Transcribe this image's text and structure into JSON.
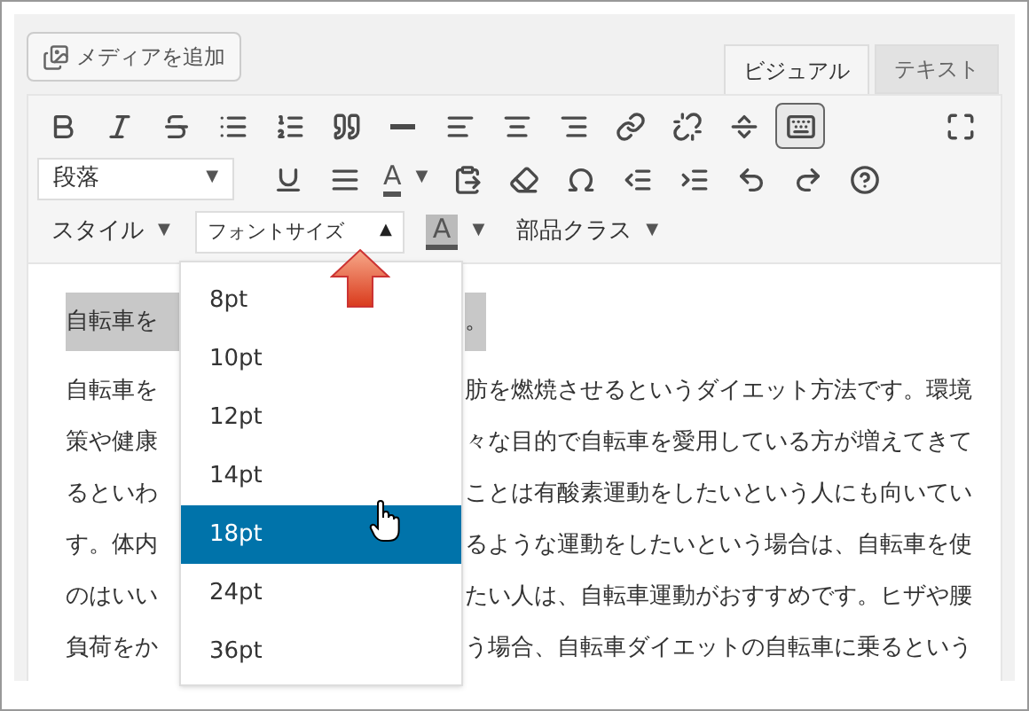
{
  "media_button": {
    "label": "メディアを追加"
  },
  "tabs": [
    {
      "label": "ビジュアル",
      "selected": true
    },
    {
      "label": "テキスト",
      "selected": false
    }
  ],
  "toolbar_row_1": [
    {
      "selected": false
    },
    {
      "selected": false
    },
    {
      "selected": false
    },
    {
      "selected": false
    },
    {
      "selected": false
    },
    {
      "selected": false
    },
    {
      "selected": false
    },
    {
      "selected": false
    },
    {
      "selected": false
    },
    {
      "selected": false
    },
    {
      "selected": false
    },
    {
      "selected": false
    },
    {
      "selected": false
    },
    {
      "selected": true
    },
    {
      "selected": false
    }
  ],
  "format_select": {
    "value": "段落",
    "caret": "▼"
  },
  "text_color": {
    "label": "A",
    "caret": "▼"
  },
  "style_menu": {
    "label": "スタイル",
    "caret": "▼"
  },
  "font_size_menu": {
    "label": "フォントサイズ",
    "caret": "▲",
    "open": true
  },
  "background_color": {
    "label": "A",
    "caret": "▼"
  },
  "parts_class_menu": {
    "label": "部品クラス",
    "caret": "▼"
  },
  "font_size_options": [
    {
      "label": "8pt",
      "selected": false
    },
    {
      "label": "10pt",
      "selected": false
    },
    {
      "label": "12pt",
      "selected": false
    },
    {
      "label": "14pt",
      "selected": false
    },
    {
      "label": "18pt",
      "selected": true
    },
    {
      "label": "24pt",
      "selected": false
    },
    {
      "label": "36pt",
      "selected": false
    }
  ],
  "content": {
    "heading": {
      "left": "自転車を",
      "right": "。",
      "highlighted": true
    },
    "lines": [
      {
        "left": "自転車を",
        "right": "肪を燃焼させるというダイエット方法です。環境"
      },
      {
        "left": "策や健康",
        "right": "々な目的で自転車を愛用している方が増えてきて"
      },
      {
        "left": "るといわ",
        "right": "ことは有酸素運動をしたいという人にも向いてい"
      },
      {
        "left": "す。体内",
        "right": "るような運動をしたいという場合は、自転車を使"
      },
      {
        "left": "のはいい",
        "right": "たい人は、自転車運動がおすすめです。ヒザや腰"
      },
      {
        "left": "負荷をか",
        "right": "う場合、自転車ダイエットの自転車に乗るという"
      }
    ]
  }
}
